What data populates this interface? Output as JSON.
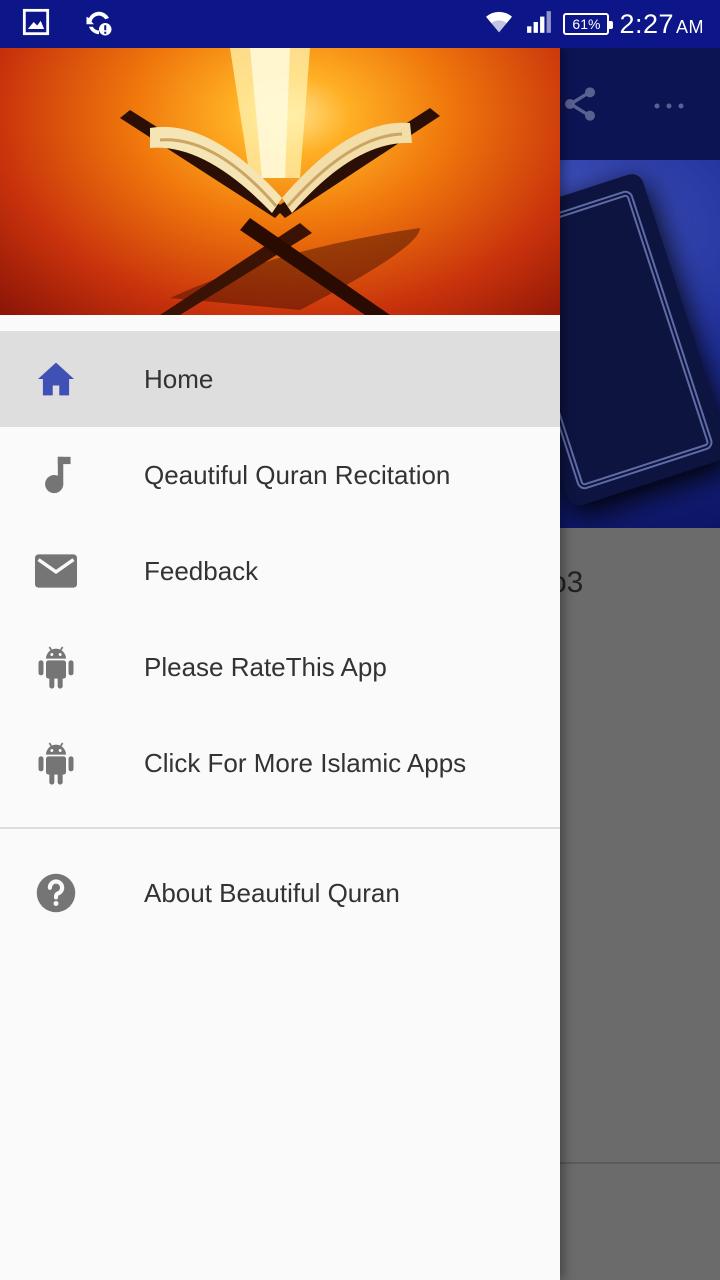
{
  "status_bar": {
    "battery": "61%",
    "time": "2:27",
    "am_pm": "AM",
    "icons": [
      "gallery-icon",
      "sync-alert-icon",
      "wifi-icon",
      "signal-icon",
      "battery-icon"
    ]
  },
  "background": {
    "partial_text": "o3",
    "icons": [
      "share-icon",
      "more-vert-icon"
    ]
  },
  "drawer": {
    "header_image": "quran-on-stand-banner",
    "items": [
      {
        "label": "Home",
        "icon": "home-icon",
        "active": true
      },
      {
        "label": "Qeautiful Quran Recitation",
        "icon": "music-note-icon"
      },
      {
        "label": "Feedback",
        "icon": "mail-icon"
      },
      {
        "label": "Please RateThis App",
        "icon": "android-icon"
      },
      {
        "label": "Click For More Islamic Apps",
        "icon": "android-icon"
      }
    ],
    "secondary_items": [
      {
        "label": "About Beautiful Quran",
        "icon": "help-icon"
      }
    ]
  },
  "colors": {
    "status_bar": "#0c1689",
    "accent": "#3f51b5",
    "icon_gray": "#757575",
    "active_bg": "#dedede"
  }
}
